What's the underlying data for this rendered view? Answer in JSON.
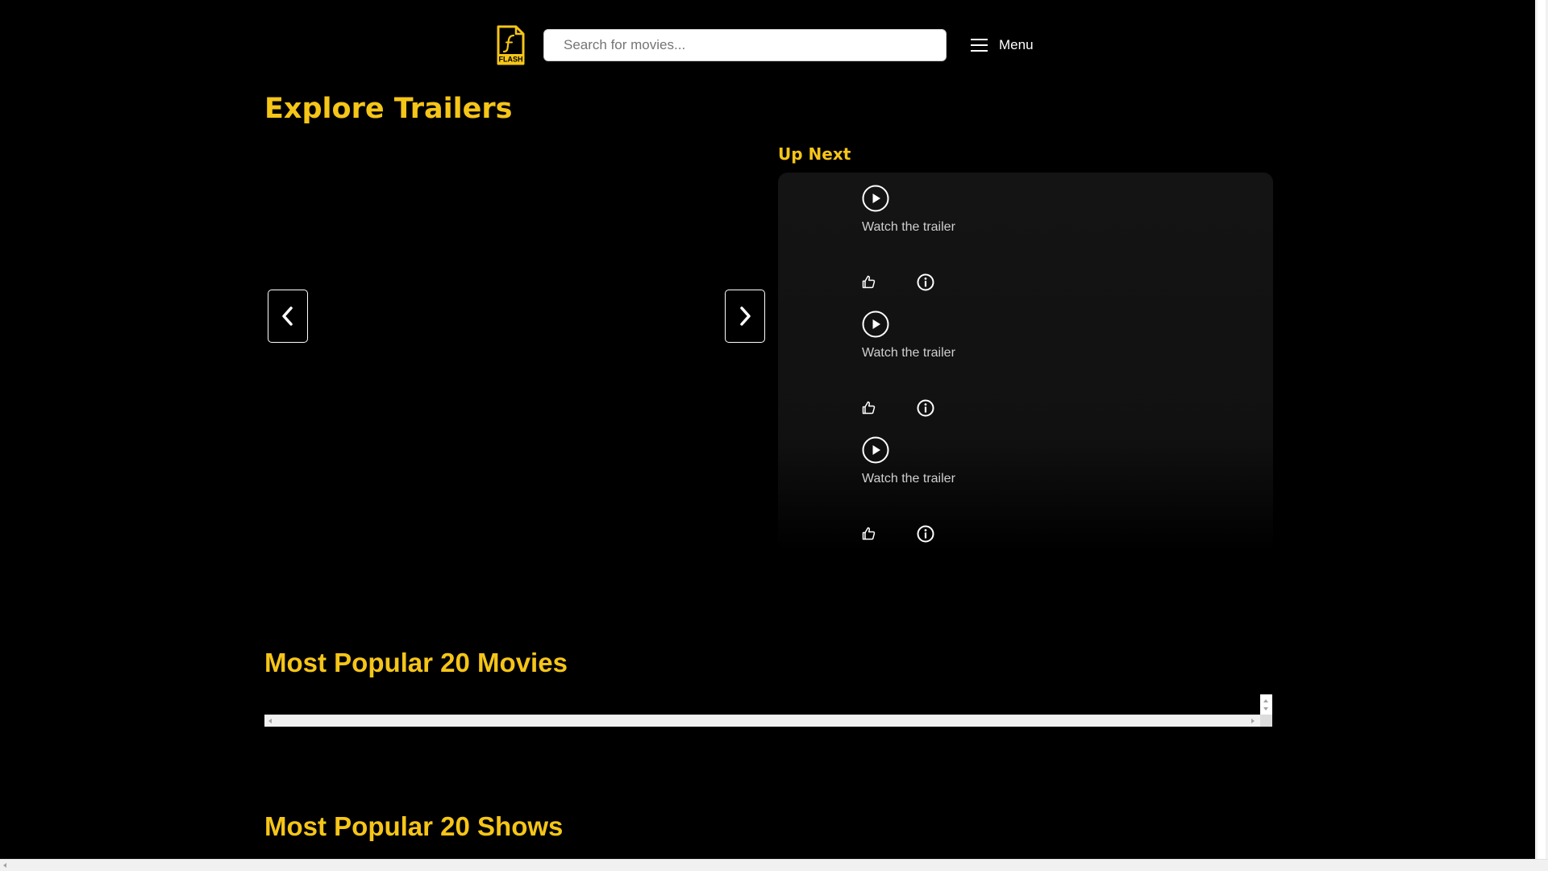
{
  "header": {
    "logo_text": "FLASH",
    "search_placeholder": "Search for movies...",
    "menu_label": "Menu"
  },
  "explore": {
    "title": "Explore Trailers"
  },
  "up_next": {
    "title": "Up Next",
    "items": [
      {
        "label": "Watch the trailer"
      },
      {
        "label": "Watch the trailer"
      },
      {
        "label": "Watch the trailer"
      }
    ]
  },
  "sections": {
    "movies_title": "Most Popular 20 Movies",
    "shows_title": "Most Popular 20 Shows"
  },
  "colors": {
    "accent": "#f5c518",
    "background": "#000000"
  },
  "icons": [
    "flash-logo-icon",
    "menu-icon",
    "chevron-left-icon",
    "chevron-right-icon",
    "play-circle-icon",
    "thumbs-up-icon",
    "info-icon"
  ]
}
